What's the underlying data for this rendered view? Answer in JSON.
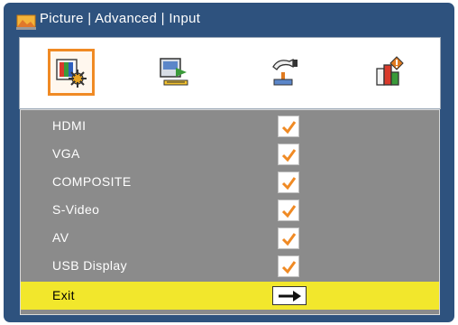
{
  "header": {
    "title": "Picture | Advanced | Input"
  },
  "tabs": [
    {
      "icon": "picture-settings-icon",
      "selected": true
    },
    {
      "icon": "display-settings-icon",
      "selected": false
    },
    {
      "icon": "setup-icon",
      "selected": false
    },
    {
      "icon": "options-icon",
      "selected": false
    }
  ],
  "inputs": [
    {
      "label": "HDMI",
      "checked": true
    },
    {
      "label": "VGA",
      "checked": true
    },
    {
      "label": "COMPOSITE",
      "checked": true
    },
    {
      "label": "S-Video",
      "checked": true
    },
    {
      "label": "AV",
      "checked": true
    },
    {
      "label": "USB Display",
      "checked": true
    }
  ],
  "exit": {
    "label": "Exit",
    "icon": "arrow-right-icon"
  },
  "colors": {
    "frame": "#2e527e",
    "accent": "#f08a24",
    "highlight": "#f2e72c",
    "panel": "#8b8b8b"
  }
}
